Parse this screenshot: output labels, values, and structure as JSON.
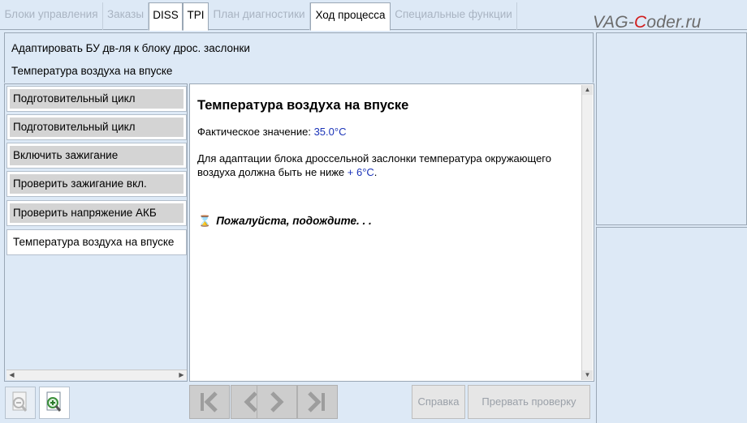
{
  "tabs": [
    {
      "label": "Блоки управления",
      "state": "disabled"
    },
    {
      "label": "Заказы",
      "state": "disabled"
    },
    {
      "label": "DISS",
      "state": "active"
    },
    {
      "label": "TPI",
      "state": "active"
    },
    {
      "label": "План диагностики",
      "state": "disabled"
    },
    {
      "label": "Ход процесса",
      "state": "active"
    },
    {
      "label": "Специальные функции",
      "state": "disabled"
    }
  ],
  "watermark": {
    "prefix": "VAG-",
    "highlight": "C",
    "suffix": "oder.ru"
  },
  "header": {
    "line1": "Адаптировать БУ дв-ля к блоку дрос. заслонки",
    "line2": "Температура воздуха на впуске"
  },
  "steps": [
    {
      "label": "Подготовительный цикл"
    },
    {
      "label": "Подготовительный цикл"
    },
    {
      "label": "Включить зажигание"
    },
    {
      "label": "Проверить зажигание вкл."
    },
    {
      "label": "Проверить напряжение АКБ"
    },
    {
      "label": "Температура воздуха на впуске"
    }
  ],
  "content": {
    "title": "Температура воздуха на впуске",
    "actual_label": "Фактическое значение: ",
    "actual_value": "35.0°C",
    "para_text": "Для адаптации блока дроссельной заслонки температура окружающего воздуха должна быть не ниже ",
    "para_value": "+ 6°C",
    "para_end": ".",
    "wait_text": "Пожалуйста, подождите. . ."
  },
  "buttons": {
    "help": "Справка",
    "abort": "Прервать проверку"
  },
  "icons": {
    "hourglass": "hourglass-icon",
    "zoom_out": "zoom-out-icon",
    "zoom_in": "zoom-in-icon",
    "first": "first-page-icon",
    "prev": "previous-icon",
    "next": "next-icon",
    "last": "last-page-icon"
  },
  "colors": {
    "accent_blue": "#1a33b8",
    "panel_bg": "#dde9f6",
    "watermark_red": "#d11c1c"
  }
}
